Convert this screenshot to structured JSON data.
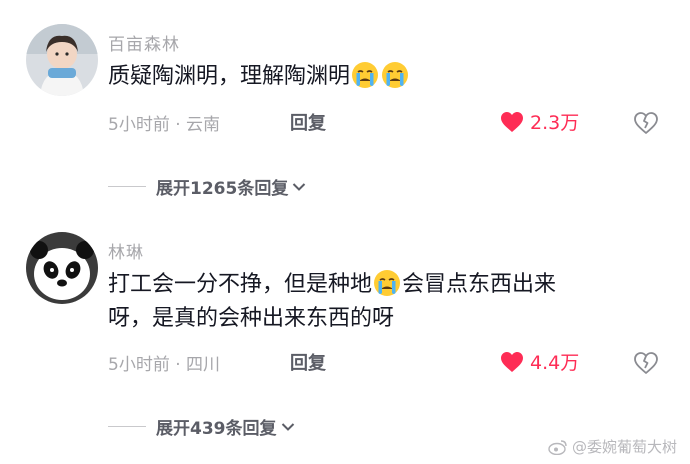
{
  "comments": [
    {
      "author": "百亩森林",
      "text": "质疑陶渊明，理解陶渊明",
      "emoji": "crying-face",
      "meta": "5小时前 · 云南",
      "reply_label": "回复",
      "likes": "2.3万",
      "expand_label": "展开1265条回复"
    },
    {
      "author": "林琳",
      "text_part1": "打工会一分不挣，但是种地",
      "text_part2": "会冒点东西出来",
      "text_line2": "呀，是真的会种出来东西的呀",
      "emoji": "crying-face",
      "meta": "5小时前 · 四川",
      "reply_label": "回复",
      "likes": "4.4万",
      "expand_label": "展开439条回复"
    }
  ],
  "watermark": "@委婉葡萄大树",
  "colors": {
    "like_red": "#fe2c55",
    "text_dark": "#161823",
    "text_gray": "#a7a7ab"
  }
}
